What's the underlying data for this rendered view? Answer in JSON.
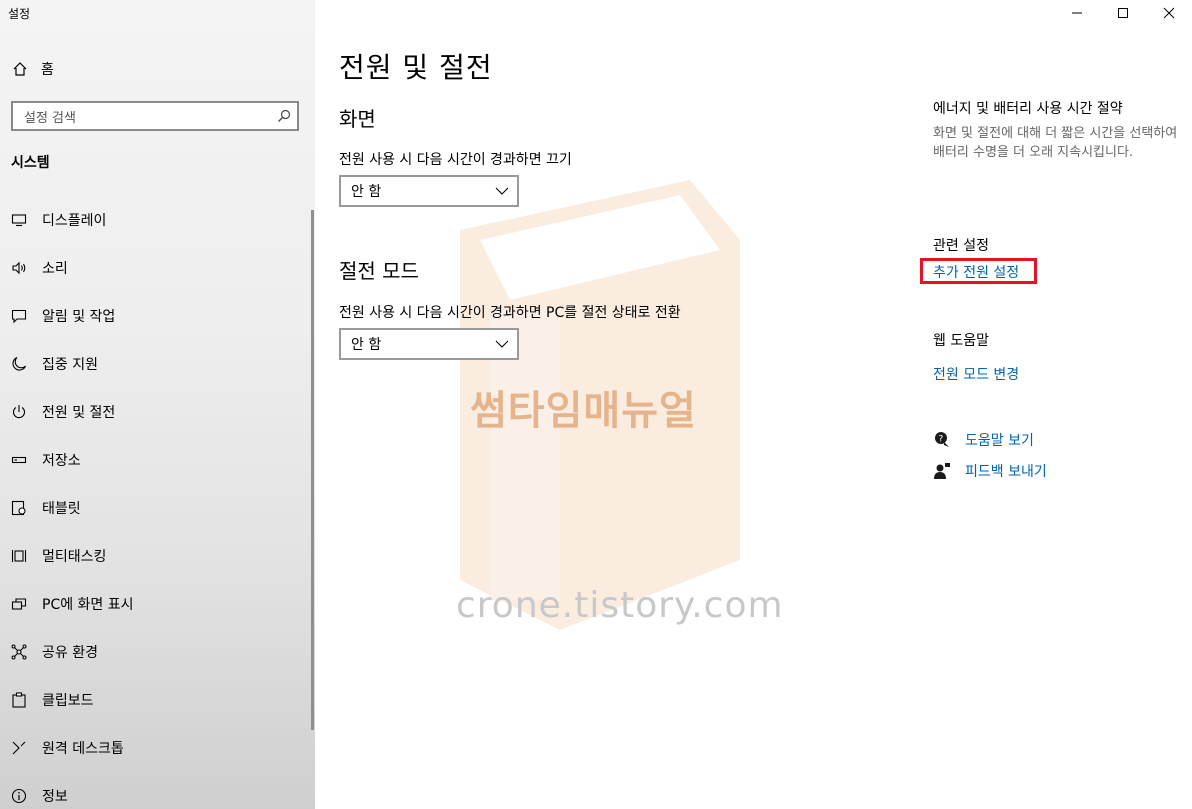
{
  "window": {
    "title": "설정",
    "controls": {
      "minimize": "minimize-icon",
      "maximize": "maximize-icon",
      "close": "close-icon"
    }
  },
  "sidebar": {
    "home_label": "홈",
    "search_placeholder": "설정 검색",
    "section_title": "시스템",
    "items": [
      {
        "label": "디스플레이",
        "icon": "monitor-icon"
      },
      {
        "label": "소리",
        "icon": "speaker-icon"
      },
      {
        "label": "알림 및 작업",
        "icon": "notification-icon"
      },
      {
        "label": "집중 지원",
        "icon": "moon-icon"
      },
      {
        "label": "전원 및 절전",
        "icon": "power-icon"
      },
      {
        "label": "저장소",
        "icon": "storage-icon"
      },
      {
        "label": "태블릿",
        "icon": "tablet-icon"
      },
      {
        "label": "멀티태스킹",
        "icon": "multitasking-icon"
      },
      {
        "label": "PC에 화면 표시",
        "icon": "project-icon"
      },
      {
        "label": "공유 환경",
        "icon": "share-icon"
      },
      {
        "label": "클립보드",
        "icon": "clipboard-icon"
      },
      {
        "label": "원격 데스크톱",
        "icon": "remote-desktop-icon"
      },
      {
        "label": "정보",
        "icon": "info-icon"
      }
    ]
  },
  "main": {
    "title": "전원 및 절전",
    "screen": {
      "heading": "화면",
      "label": "전원 사용 시 다음 시간이 경과하면 끄기",
      "value": "안 함"
    },
    "sleep": {
      "heading": "절전 모드",
      "label": "전원 사용 시 다음 시간이 경과하면 PC를 절전 상태로 전환",
      "value": "안 함"
    }
  },
  "right": {
    "energy_heading": "에너지 및 배터리 사용 시간 절약",
    "energy_desc": "화면 및 절전에 대해 더 짧은 시간을 선택하여 배터리 수명을 더 오래 지속시킵니다.",
    "related_heading": "관련 설정",
    "related_link": "추가 전원 설정",
    "web_help_heading": "웹 도움말",
    "web_help_link": "전원 모드 변경",
    "get_help": "도움말 보기",
    "feedback": "피드백 보내기"
  },
  "watermark": {
    "brand": "썸타임매뉴얼",
    "url": "crone.tistory.com"
  },
  "colors": {
    "accent": "#0063b1",
    "highlight": "#e81123"
  }
}
